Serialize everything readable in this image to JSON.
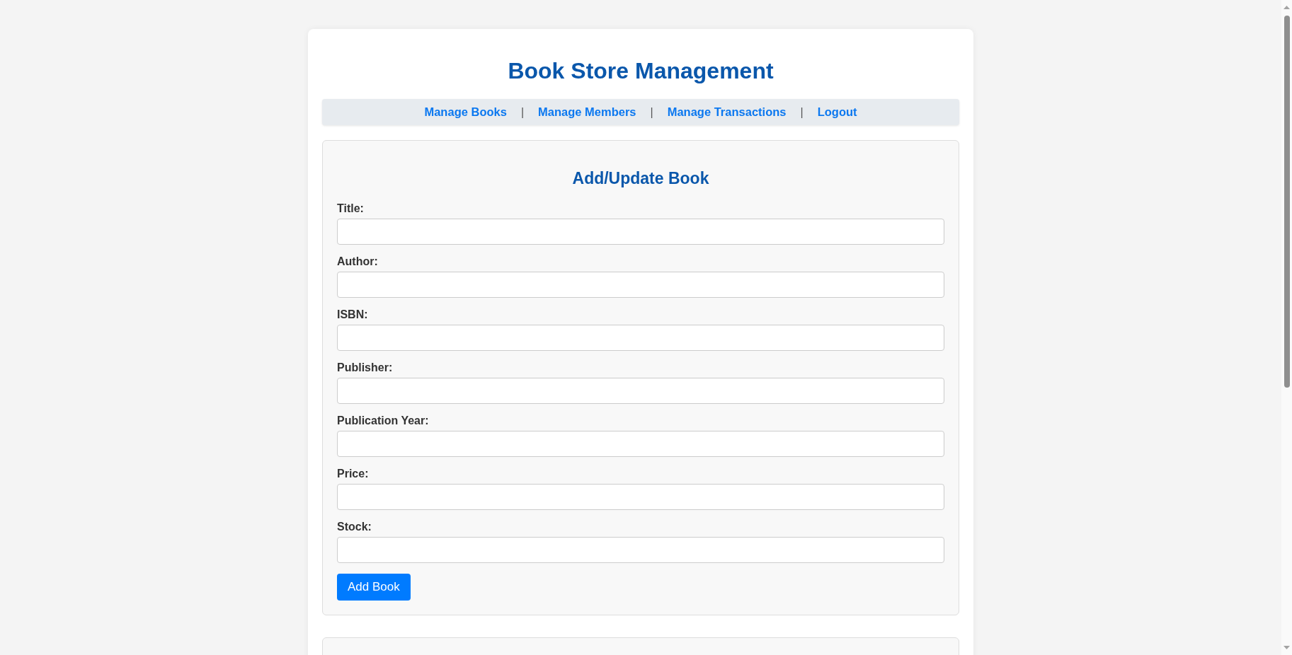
{
  "header": {
    "title": "Book Store Management"
  },
  "nav": {
    "links": [
      "Manage Books",
      "Manage Members",
      "Manage Transactions",
      "Logout"
    ],
    "separator": "|"
  },
  "form": {
    "title": "Add/Update Book",
    "fields": [
      {
        "label": "Title:"
      },
      {
        "label": "Author:"
      },
      {
        "label": "ISBN:"
      },
      {
        "label": "Publisher:"
      },
      {
        "label": "Publication Year:"
      },
      {
        "label": "Price:"
      },
      {
        "label": "Stock:"
      }
    ],
    "submit": "Add Book"
  }
}
